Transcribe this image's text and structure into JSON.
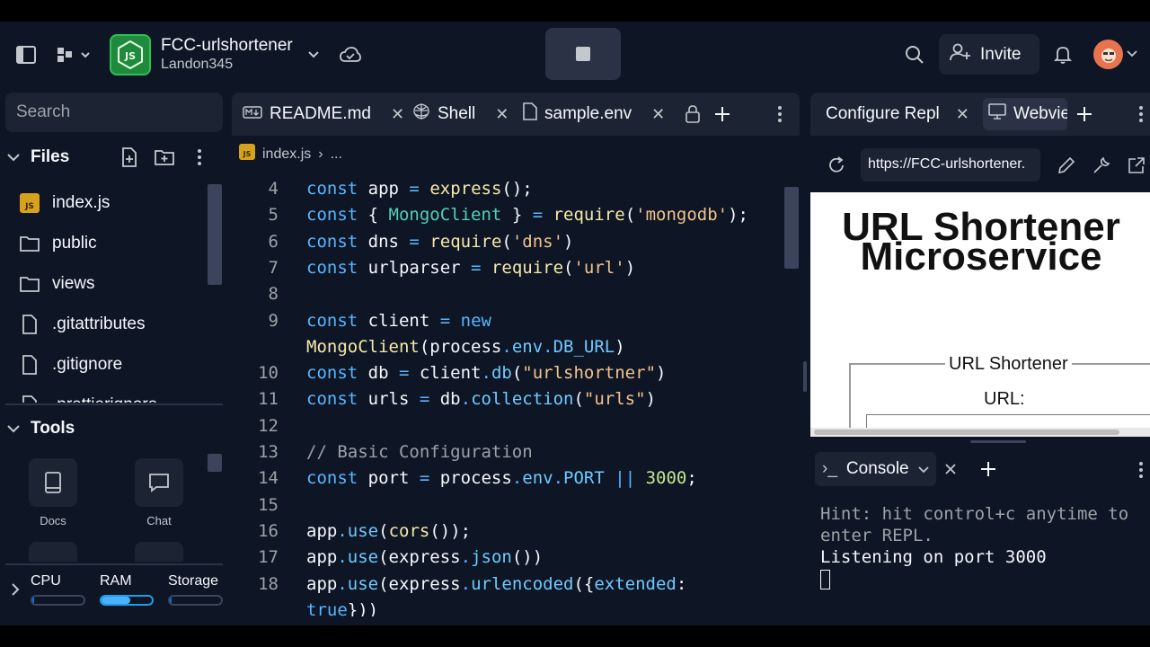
{
  "header": {
    "repl_name": "FCC-urlshortener",
    "owner": "Landon345",
    "invite_label": "Invite"
  },
  "sidebar": {
    "search_placeholder": "Search",
    "files_heading": "Files",
    "files": [
      {
        "name": "index.js",
        "icon": "js-file-icon"
      },
      {
        "name": "public",
        "icon": "folder-icon"
      },
      {
        "name": "views",
        "icon": "folder-icon"
      },
      {
        "name": ".gitattributes",
        "icon": "file-icon"
      },
      {
        "name": ".gitignore",
        "icon": "file-icon"
      },
      {
        "name": ".prettierignore",
        "icon": "file-icon"
      }
    ],
    "tools_heading": "Tools",
    "tools": [
      {
        "label": "Docs",
        "icon": "book-icon"
      },
      {
        "label": "Chat",
        "icon": "chat-icon"
      }
    ],
    "resources": {
      "cpu_label": "CPU",
      "ram_label": "RAM",
      "storage_label": "Storage"
    }
  },
  "editor": {
    "tabs": [
      {
        "label": "README.md",
        "icon": "markdown-icon"
      },
      {
        "label": "Shell",
        "icon": "shell-icon"
      },
      {
        "label": "sample.env",
        "icon": "file-icon"
      }
    ],
    "breadcrumb": {
      "file": "index.js",
      "more": "..."
    },
    "lines": [
      {
        "num": "4",
        "html": "<span class='kw'>const</span> app <span class='op'>=</span> <span class='fn'>express</span>();"
      },
      {
        "num": "5",
        "html": "<span class='kw'>const</span> { <span class='cls'>MongoClient</span> } <span class='op'>=</span> <span class='fn'>require</span>(<span class='str'>'mongodb'</span>);"
      },
      {
        "num": "6",
        "html": "<span class='kw'>const</span> dns <span class='op'>=</span> <span class='fn'>require</span>(<span class='str'>'dns'</span>)"
      },
      {
        "num": "7",
        "html": "<span class='kw'>const</span> urlparser <span class='op'>=</span> <span class='fn'>require</span>(<span class='str'>'url'</span>)"
      },
      {
        "num": "8",
        "html": ""
      },
      {
        "num": "9",
        "html": "<span class='kw'>const</span> client <span class='op'>=</span> <span class='kw'>new</span>"
      },
      {
        "num": "",
        "html": "<span class='fn'>MongoClient</span>(process<span class='op'>.</span><span class='prop'>env</span><span class='op'>.</span><span class='prop'>DB_URL</span>)"
      },
      {
        "num": "10",
        "html": "<span class='kw'>const</span> db <span class='op'>=</span> client<span class='op'>.</span><span class='prop'>db</span>(<span class='str'>\"urlshortner\"</span>)"
      },
      {
        "num": "11",
        "html": "<span class='kw'>const</span> urls <span class='op'>=</span> db<span class='op'>.</span><span class='prop'>collection</span>(<span class='str'>\"urls\"</span>)"
      },
      {
        "num": "12",
        "html": ""
      },
      {
        "num": "13",
        "html": "<span class='cm'>// Basic Configuration</span>"
      },
      {
        "num": "14",
        "html": "<span class='kw'>const</span> port <span class='op'>=</span> process<span class='op'>.</span><span class='prop'>env</span><span class='op'>.</span><span class='prop'>PORT</span> <span class='op'>||</span> <span class='num'>3000</span>;"
      },
      {
        "num": "15",
        "html": ""
      },
      {
        "num": "16",
        "html": "app<span class='op'>.</span><span class='prop'>use</span>(<span class='fn'>cors</span>());"
      },
      {
        "num": "17",
        "html": "app<span class='op'>.</span><span class='prop'>use</span>(express<span class='op'>.</span><span class='prop'>json</span>())"
      },
      {
        "num": "18",
        "html": "app<span class='op'>.</span><span class='prop'>use</span>(express<span class='op'>.</span><span class='prop'>urlencoded</span>({<span class='prop'>extended</span>:"
      },
      {
        "num": "",
        "html": "<span class='kw'>true</span>}))"
      }
    ]
  },
  "right": {
    "tabs": [
      {
        "label": "Configure Repl",
        "icon": "none"
      },
      {
        "label": "Webview",
        "icon": "monitor-icon"
      }
    ],
    "url": "https://FCC-urlshortener.",
    "webview": {
      "title": "URL Shortener Microservice",
      "legend": "URL Shortener",
      "field_label": "URL:"
    },
    "console_tab_label": "Console",
    "console_hint": "Hint: hit control+c anytime to enter REPL.",
    "console_output": "Listening on port 3000"
  },
  "colors": {
    "background": "#0e1525",
    "surface": "#1c2333",
    "accent": "#0079f2",
    "repl_icon": "#1f8a3c"
  }
}
